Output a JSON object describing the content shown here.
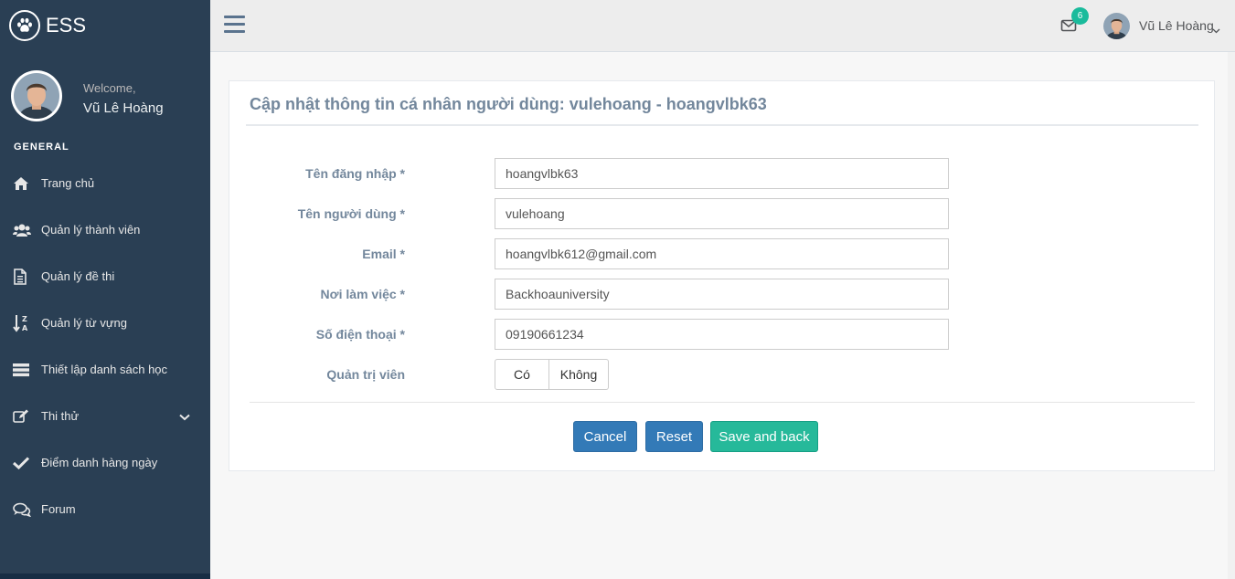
{
  "brand": {
    "title": "ESS",
    "logo_icon": "paw-icon"
  },
  "profile": {
    "welcome": "Welcome,",
    "name": "Vũ Lê Hoàng"
  },
  "sidebar": {
    "section_title": "GENERAL",
    "items": [
      {
        "label": "Trang chủ",
        "icon": "home-icon"
      },
      {
        "label": "Quản lý thành viên",
        "icon": "users-icon"
      },
      {
        "label": "Quản lý đề thi",
        "icon": "file-icon"
      },
      {
        "label": "Quản lý từ vựng",
        "icon": "sort-alpha-icon"
      },
      {
        "label": "Thiết lập danh sách học",
        "icon": "list-icon"
      },
      {
        "label": "Thi thử",
        "icon": "edit-icon"
      },
      {
        "label": "Điểm danh hàng ngày",
        "icon": "check-icon"
      },
      {
        "label": "Forum",
        "icon": "comments-icon"
      }
    ]
  },
  "topnav": {
    "mail_badge": "6",
    "user_name": "Vũ Lê Hoàng"
  },
  "panel": {
    "title": "Cập nhật thông tin cá nhân người dùng: vulehoang - hoangvlbk63"
  },
  "form": {
    "fields": [
      {
        "label": "Tên đăng nhập *",
        "value": "hoangvlbk63"
      },
      {
        "label": "Tên người dùng *",
        "value": "vulehoang"
      },
      {
        "label": "Email *",
        "value": "hoangvlbk612@gmail.com"
      },
      {
        "label": "Nơi làm việc *",
        "value": "Backhoauniversity"
      },
      {
        "label": "Số điện thoại *",
        "value": "09190661234"
      }
    ],
    "admin": {
      "label": "Quản trị viên",
      "yes": "Có",
      "no": "Không"
    }
  },
  "buttons": {
    "cancel": "Cancel",
    "reset": "Reset",
    "save": "Save and back"
  },
  "colors": {
    "sidebar": "#2a3f54",
    "primary": "#337ab7",
    "success": "#26b99a",
    "badge": "#1abb9c"
  }
}
